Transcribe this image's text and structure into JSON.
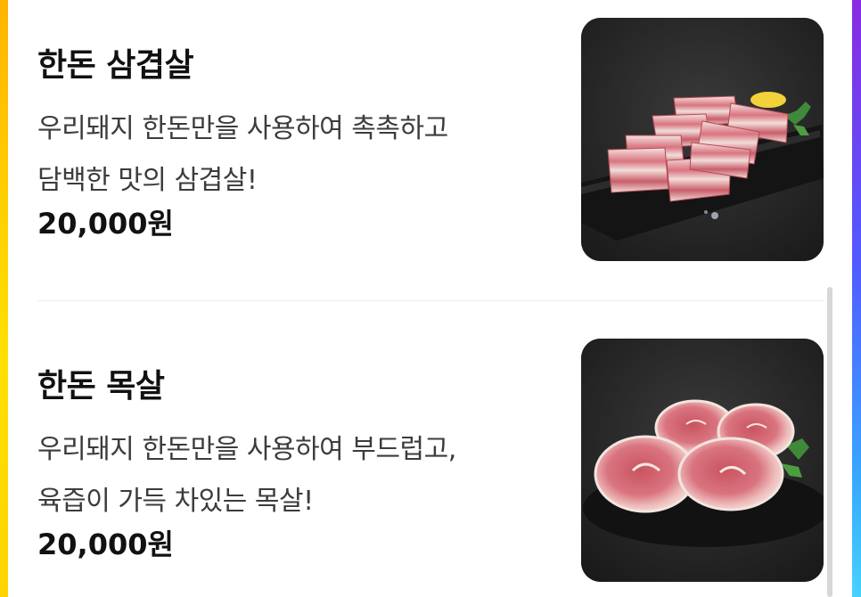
{
  "menu": {
    "items": [
      {
        "name": "한돈 삼겹살",
        "desc_line1": "우리돼지 한돈만을 사용하여 촉촉하고",
        "desc_line2": "담백한 맛의 삼겹살!",
        "price": "20,000원",
        "photo_icon": "pork-belly-photo"
      },
      {
        "name": "한돈 목살",
        "desc_line1": "우리돼지 한돈만을 사용하여 부드럽고,",
        "desc_line2": "육즙이 가득 차있는 목살!",
        "price": "20,000원",
        "photo_icon": "pork-neck-photo"
      }
    ]
  },
  "colors": {
    "photo_background": "#262626",
    "meat_pink": "#d9747f",
    "fat_white": "#f3e6e2",
    "left_edge": "#ffd000",
    "right_edge": "#4f5cff"
  }
}
